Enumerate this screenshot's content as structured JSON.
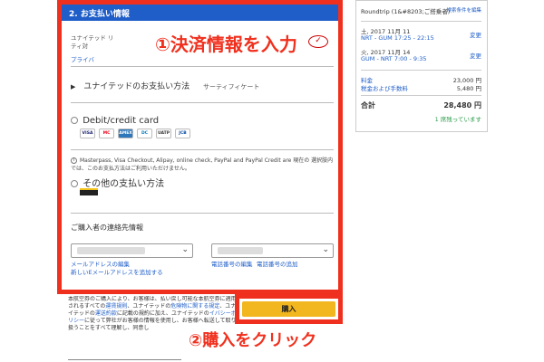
{
  "payment_panel": {
    "header": "2. お支払い情報",
    "annotation": "①決済情報を入力",
    "united_note": "ユナイテッド リティ対",
    "privacy_link": "プライバ",
    "check_logo": "✓",
    "united_payment": {
      "label": "ユナイテッドのお支払い方法",
      "sub": "サーティフィケート"
    },
    "debit_credit": {
      "label": "Debit/credit card",
      "cards": [
        "VISA",
        "MC",
        "AMEX",
        "DC",
        "UATP",
        "JCB"
      ]
    },
    "info_note": "Masterpass, Visa Checkout, Alipay, online check, PayPal and PayPal Credit are 現在の 選択肢内では、このお支払方法はご利用いただけません。",
    "other_methods": "その他の支払い方法",
    "contact_title": "ご購入者の連絡先情報",
    "email_links": [
      "メールアドレスの編集",
      "新しいEメールアドレスを追加する"
    ],
    "phone_links": [
      "電話番号の編集",
      "電話番号の追加"
    ]
  },
  "legal": {
    "text_1": "本航空券のご購入により、お客様は、払い戻し可能な本航空券に適用されるすべての",
    "link_1": "運賃規則",
    "text_2": "、ユナイテッドの",
    "link_2": "危険物に関する規定",
    "text_3": "、ユナイテッドの",
    "link_3": "運送約款",
    "text_4": "に記載の",
    "text_5": "規約に加え、ユナイテッドの",
    "link_4": "イバシーポリシー",
    "text_6": "に従って弊社がお客様の情報を使用し、お客様へ転送して取り扱うことをすべて理解し、同意し"
  },
  "purchase": {
    "button": "購入",
    "annotation": "②購入をクリック"
  },
  "summary": {
    "trip_type": "Roundtrip (1&#8203;ご搭乗者)",
    "details_link": "検索条件を編集",
    "flight1_date": "土, 2017 11月 11",
    "flight1_route": "NRT - GUM 17:25 - 22:15",
    "flight2_date": "火, 2017 11月 14",
    "flight2_route": "GUM - NRT 7:00 - 9:35",
    "change": "変更",
    "fare_label": "料金",
    "fare_value": "23,000 円",
    "tax_label": "税金および手数料",
    "tax_value": "5,480 円",
    "total_label": "合計",
    "total_value": "28,480 円",
    "status": "1 席残っています"
  }
}
